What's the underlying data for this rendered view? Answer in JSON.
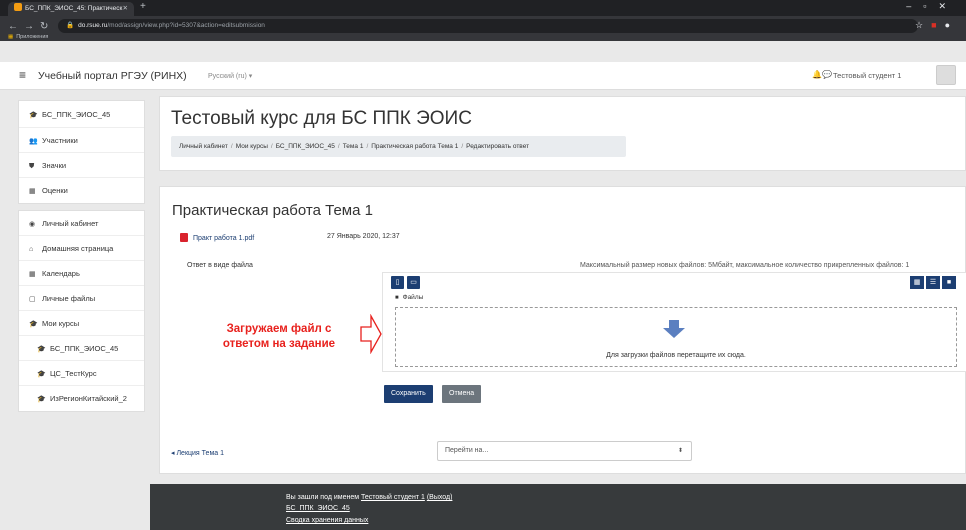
{
  "browser": {
    "tab_title": "БС_ППК_ЭИОС_45: Практическ",
    "address_host": "do.rsue.ru",
    "address_path": "/mod/assign/view.php?id=5307&action=editsubmission",
    "bookmarks_label": "Приложения"
  },
  "navbar": {
    "portal_title": "Учебный портал РГЭУ (РИНХ)",
    "language": "Русский (ru) ▾",
    "user_name": "Тестовый студент 1"
  },
  "drawer": {
    "group1": [
      {
        "icon": "graduation-cap-icon",
        "glyph": "🎓",
        "label": "БС_ППК_ЭИОС_45"
      },
      {
        "icon": "users-icon",
        "glyph": "👥",
        "label": "Участники"
      },
      {
        "icon": "badge-icon",
        "glyph": "⛊",
        "label": "Значки"
      },
      {
        "icon": "grades-icon",
        "glyph": "▦",
        "label": "Оценки"
      }
    ],
    "group2": [
      {
        "icon": "dashboard-icon",
        "glyph": "◉",
        "label": "Личный кабинет"
      },
      {
        "icon": "home-icon",
        "glyph": "⌂",
        "label": "Домашняя страница"
      },
      {
        "icon": "calendar-icon",
        "glyph": "▦",
        "label": "Календарь"
      },
      {
        "icon": "file-icon",
        "glyph": "▢",
        "label": "Личные файлы"
      },
      {
        "icon": "graduation-cap-icon",
        "glyph": "🎓",
        "label": "Мои курсы"
      },
      {
        "icon": "graduation-cap-icon",
        "glyph": "🎓",
        "label": "БС_ППК_ЭИОС_45"
      },
      {
        "icon": "graduation-cap-icon",
        "glyph": "🎓",
        "label": "ЦС_ТестКурс"
      },
      {
        "icon": "graduation-cap-icon",
        "glyph": "🎓",
        "label": "ИзРегионКитайский_2"
      }
    ]
  },
  "course": {
    "title": "Тестовый курс для БС ППК ЭОИС",
    "breadcrumb": [
      "Личный кабинет",
      "Мои курсы",
      "БС_ППК_ЭИОС_45",
      "Тема 1",
      "Практическая работа Тема 1",
      "Редактировать ответ"
    ]
  },
  "assignment": {
    "title": "Практическая работа Тема 1",
    "file_name": "Практ работа 1.pdf",
    "file_date": "27 Январь 2020, 12:37",
    "field_label": "Ответ в виде файла",
    "max_info": "Максимальный размер новых файлов: 5Мбайт, максимальное количество прикрепленных файлов: 1",
    "folder_label": "Файлы",
    "drop_text": "Для загрузки файлов перетащите их сюда.",
    "annotation_line1": "Загружаем файл с",
    "annotation_line2": "ответом на задание",
    "save_label": "Сохранить",
    "cancel_label": "Отмена",
    "prev_link": "◂ Лекция Тема 1",
    "jump_placeholder": "Перейти на..."
  },
  "footer": {
    "logged_in_prefix": "Вы зашли под именем",
    "logged_in_user": "Тестовый студент 1",
    "logout": "(Выход)",
    "course_link": "БС_ППК_ЭИОС_45",
    "retention_link": "Сводка хранения данных"
  },
  "colors": {
    "primary": "#1c3e72",
    "annotation": "#e8211d",
    "footer_bg": "#373a3c"
  }
}
